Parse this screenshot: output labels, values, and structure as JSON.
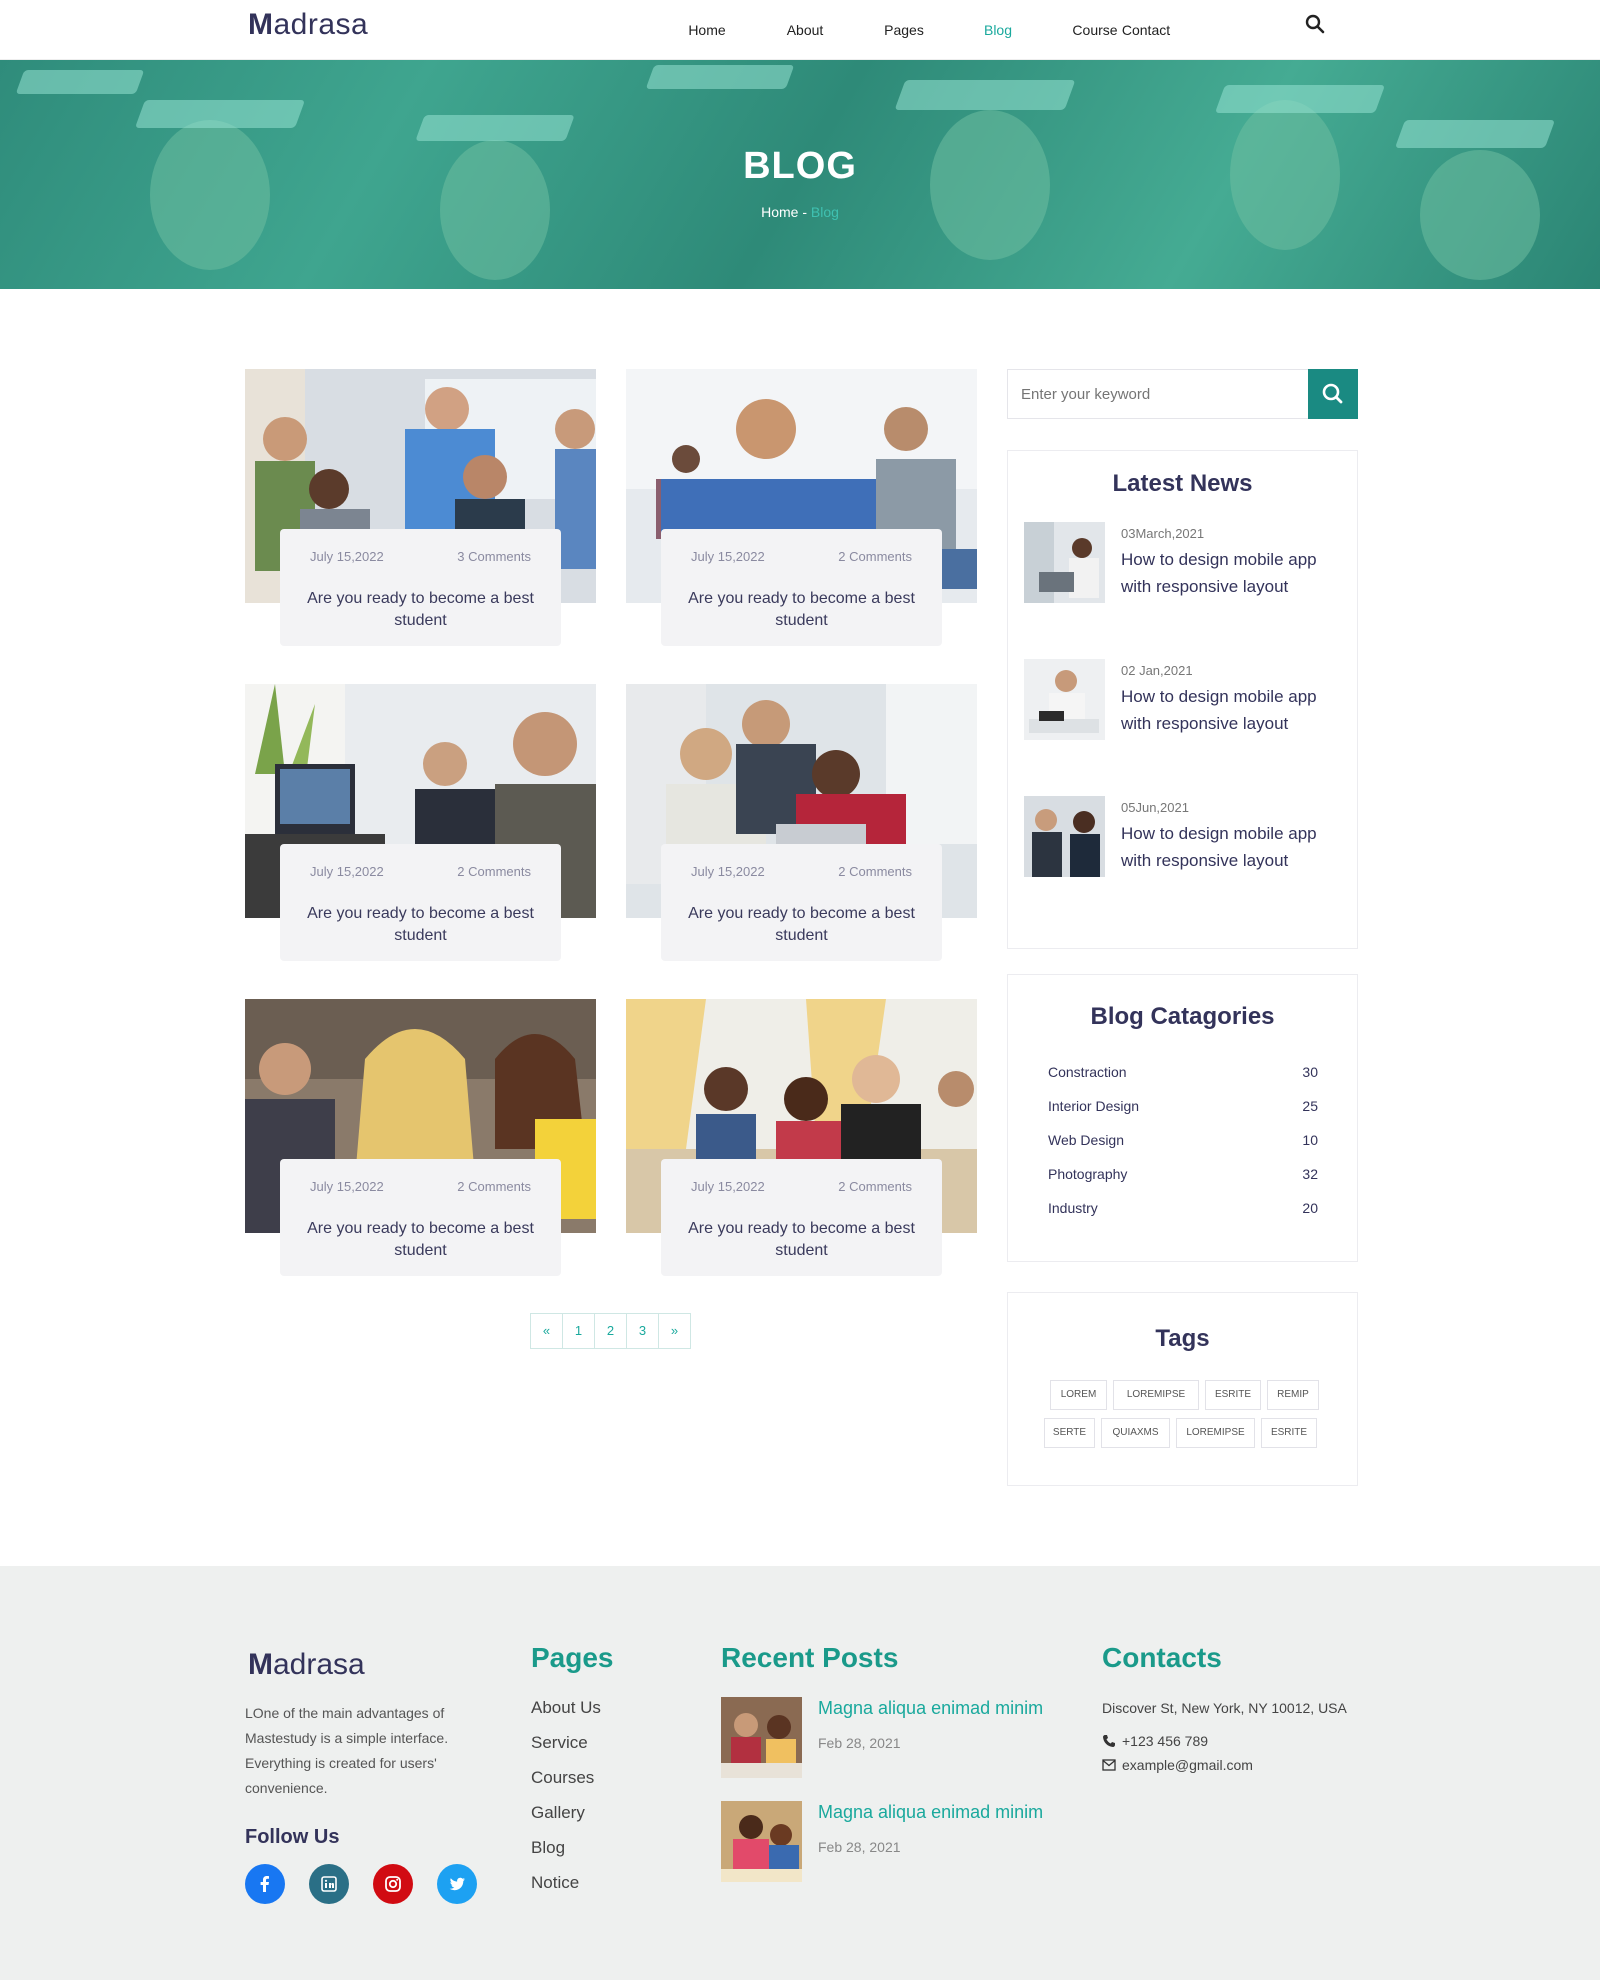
{
  "brand": {
    "logo_first": "M",
    "logo_rest": "adrasa"
  },
  "nav": {
    "items": [
      {
        "label": "Home"
      },
      {
        "label": "About"
      },
      {
        "label": "Pages"
      },
      {
        "label": "Blog"
      },
      {
        "label": "Course"
      },
      {
        "label": "Contact"
      }
    ],
    "active": "Blog",
    "search_icon": "search-icon"
  },
  "hero": {
    "title": "BLOG",
    "crumb_home": "Home",
    "crumb_sep": " - ",
    "crumb_current": "Blog"
  },
  "posts": [
    {
      "date": "July 15,2022",
      "comments": "3 Comments",
      "title": "Are you ready to become a best student"
    },
    {
      "date": "July 15,2022",
      "comments": "2 Comments",
      "title": "Are you ready to become a best student"
    },
    {
      "date": "July 15,2022",
      "comments": "2 Comments",
      "title": "Are you ready to become a best student"
    },
    {
      "date": "July 15,2022",
      "comments": "2 Comments",
      "title": "Are you ready to become a best student"
    },
    {
      "date": "July 15,2022",
      "comments": "2 Comments",
      "title": "Are you ready to become a best student"
    },
    {
      "date": "July 15,2022",
      "comments": "2 Comments",
      "title": "Are you ready to become a best student"
    }
  ],
  "pagination": {
    "prev": "«",
    "pages": [
      "1",
      "2",
      "3"
    ],
    "next": "»"
  },
  "sidebar": {
    "search_placeholder": "Enter your keyword",
    "latest_news": {
      "title": "Latest News",
      "items": [
        {
          "date": "03March,2021",
          "title": "How to design mobile app with responsive layout"
        },
        {
          "date": "02 Jan,2021",
          "title": "How to design mobile app with responsive layout"
        },
        {
          "date": "05Jun,2021",
          "title": "How to design mobile app with responsive layout"
        }
      ]
    },
    "categories": {
      "title": "Blog Catagories",
      "items": [
        {
          "name": "Constraction",
          "count": "30"
        },
        {
          "name": "Interior Design",
          "count": "25"
        },
        {
          "name": "Web Design",
          "count": "10"
        },
        {
          "name": "Photography",
          "count": "32"
        },
        {
          "name": "Industry",
          "count": "20"
        }
      ]
    },
    "tags": {
      "title": "Tags",
      "items": [
        "LOREM",
        "LOREMIPSE",
        "ESRITE",
        "REMIP",
        "SERTE",
        "QUIAXMS",
        "LOREMIPSE",
        "ESRITE"
      ]
    }
  },
  "footer": {
    "logo_first": "M",
    "logo_rest": "adrasa",
    "description": "LOne of the main advantages of Mastestudy is a simple interface. Everything is created for users' convenience.",
    "follow_title": "Follow Us",
    "social": [
      {
        "icon": "facebook-icon",
        "color": "#1877f2"
      },
      {
        "icon": "linkedin-icon",
        "color": "#2a6f86"
      },
      {
        "icon": "instagram-icon",
        "color": "#d10b12"
      },
      {
        "icon": "twitter-icon",
        "color": "#1da1f2"
      }
    ],
    "pages_title": "Pages",
    "pages": [
      "About Us",
      "Service",
      "Courses",
      "Gallery",
      "Blog",
      "Notice"
    ],
    "recent_title": "Recent Posts",
    "recent": [
      {
        "title": "Magna aliqua enimad minim",
        "date": "Feb 28, 2021"
      },
      {
        "title": "Magna aliqua enimad minim",
        "date": "Feb 28, 2021"
      }
    ],
    "contacts_title": "Contacts",
    "address": "Discover St, New York, NY 10012, USA",
    "phone": "+123 456 789",
    "email": "example@gmail.com"
  },
  "colors": {
    "accent": "#1aa99d",
    "accent_dark": "#1a8a82",
    "heading": "#33335a",
    "footer_bg": "#eef0ef"
  }
}
